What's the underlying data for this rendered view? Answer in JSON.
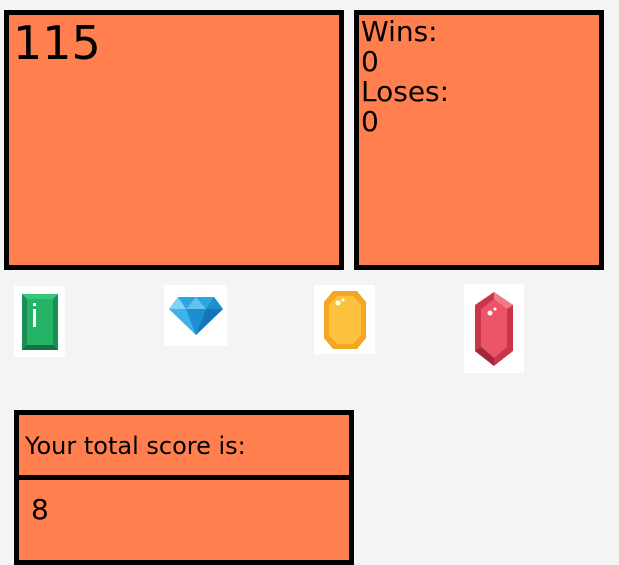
{
  "target": {
    "number": "115"
  },
  "stats": {
    "wins_label": "Wins:",
    "wins_value": "0",
    "losses_label": "Loses:",
    "losses_value": "0"
  },
  "gems": [
    {
      "name": "emerald",
      "icon": "emerald-gem-icon",
      "color": "#1fa65f"
    },
    {
      "name": "diamond",
      "icon": "diamond-gem-icon",
      "color": "#28a9e3"
    },
    {
      "name": "topaz",
      "icon": "yellow-gem-icon",
      "color": "#f8b833"
    },
    {
      "name": "ruby",
      "icon": "ruby-gem-icon",
      "color": "#e5485e"
    }
  ],
  "score": {
    "label": "Your total score is:",
    "value": "8"
  },
  "colors": {
    "panel": "#ff7f4f",
    "border": "#000000",
    "background": "#f4f4f4"
  }
}
